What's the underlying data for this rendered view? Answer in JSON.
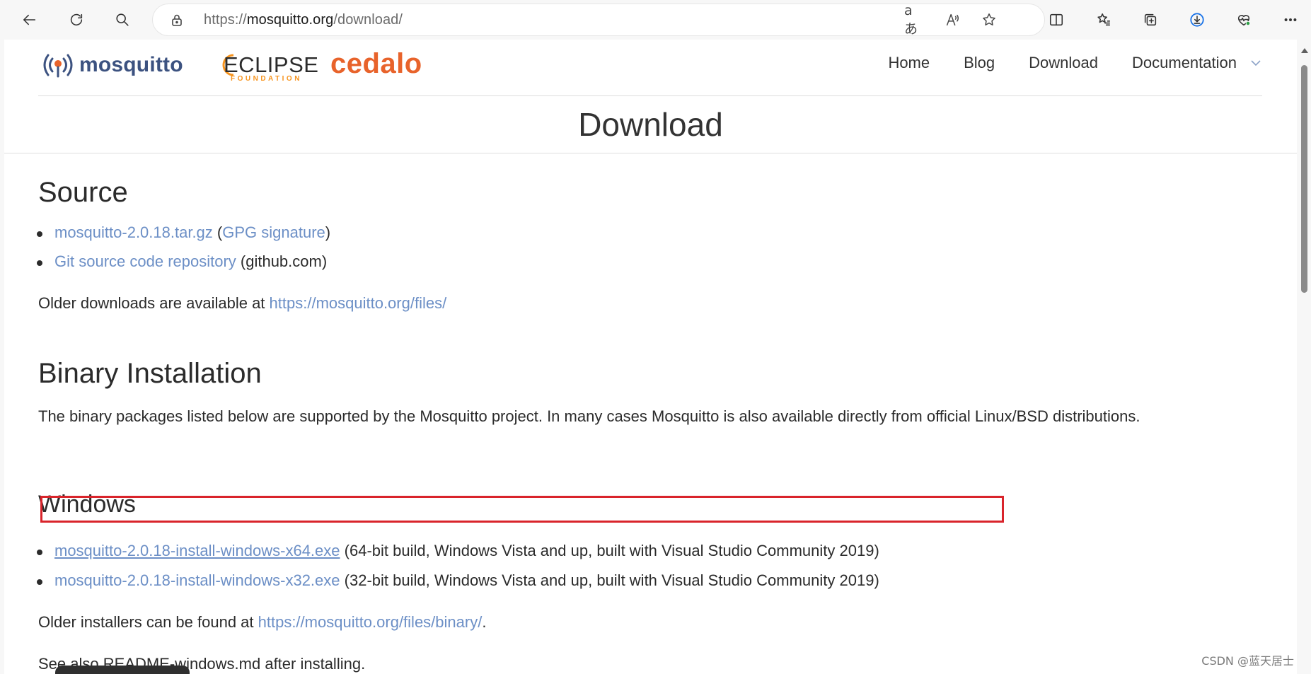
{
  "browser": {
    "url_prefix": "https://",
    "url_host": "mosquitto.org",
    "url_path": "/download/",
    "read_aloud_glyph": "A",
    "translate_glyph": "aあ"
  },
  "header": {
    "logo_mosquitto": "mosquitto",
    "logo_eclipse_main": "ECLIPSE",
    "logo_eclipse_sub": "FOUNDATION",
    "logo_cedalo": "cedalo",
    "nav": [
      "Home",
      "Blog",
      "Download",
      "Documentation"
    ]
  },
  "page_title": "Download",
  "source": {
    "heading": "Source",
    "items": [
      {
        "link": "mosquitto-2.0.18.tar.gz",
        "open": " (",
        "link2": "GPG signature",
        "close": ")"
      },
      {
        "link": "Git source code repository",
        "suffix": " (github.com)"
      }
    ],
    "older_text": "Older downloads are available at ",
    "older_link": "https://mosquitto.org/files/"
  },
  "binary": {
    "heading": "Binary Installation",
    "description": "The binary packages listed below are supported by the Mosquitto project. In many cases Mosquitto is also available directly from official Linux/BSD distributions."
  },
  "windows": {
    "heading": "Windows",
    "items": [
      {
        "link": "mosquitto-2.0.18-install-windows-x64.exe",
        "suffix": " (64-bit build, Windows Vista and up, built with Visual Studio Community 2019)"
      },
      {
        "link": "mosquitto-2.0.18-install-windows-x32.exe",
        "suffix": " (32-bit build, Windows Vista and up, built with Visual Studio Community 2019)"
      }
    ],
    "older_text": "Older installers can be found at ",
    "older_link": "https://mosquitto.org/files/binary/",
    "older_end": ".",
    "see_also": "See also README-windows.md after installing."
  },
  "watermark": "CSDN @蓝天居士",
  "colors": {
    "link": "#6c8fc6",
    "highlight": "#d9242b",
    "cedalo": "#e8632b",
    "mosquitto": "#3c5280"
  }
}
